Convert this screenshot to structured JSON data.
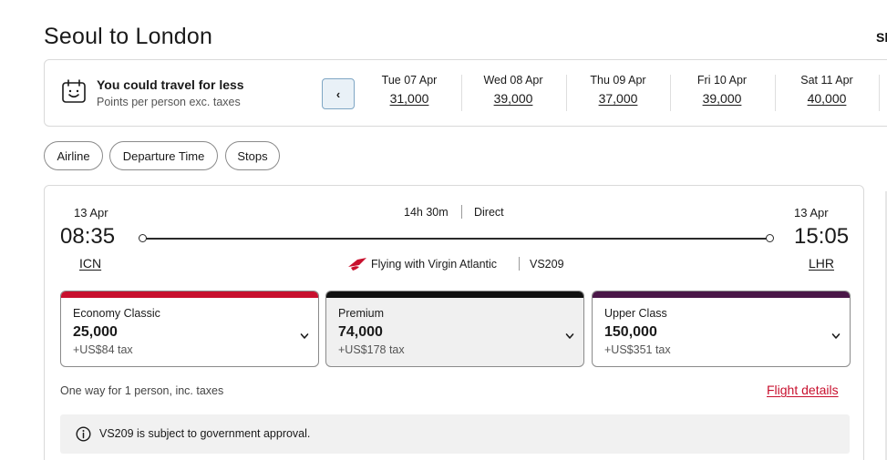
{
  "page": {
    "title": "Seoul to London",
    "top_right_cut": "Sh"
  },
  "promo": {
    "icon": "calendar-smile-icon",
    "title": "You could travel for less",
    "subtitle": "Points per person exc. taxes",
    "prev_symbol": "‹"
  },
  "dates": [
    {
      "label": "Tue 07 Apr",
      "price": "31,000"
    },
    {
      "label": "Wed 08 Apr",
      "price": "39,000"
    },
    {
      "label": "Thu 09 Apr",
      "price": "37,000"
    },
    {
      "label": "Fri 10 Apr",
      "price": "39,000"
    },
    {
      "label": "Sat 11 Apr",
      "price": "40,000"
    }
  ],
  "filters": {
    "airline": "Airline",
    "departure_time": "Departure Time",
    "stops": "Stops"
  },
  "flight": {
    "departure": {
      "date": "13 Apr",
      "time": "08:35",
      "code": "ICN"
    },
    "arrival": {
      "date": "13 Apr",
      "time": "15:05",
      "code": "LHR"
    },
    "duration": "14h 30m",
    "stops": "Direct",
    "operator": "Flying with Virgin Atlantic",
    "flight_number": "VS209",
    "cabins": [
      {
        "name": "Economy Classic",
        "price": "25,000",
        "tax": "+US$84 tax",
        "color": "#c8102e",
        "bg": "#ffffff"
      },
      {
        "name": "Premium",
        "price": "74,000",
        "tax": "+US$178 tax",
        "color": "#111111",
        "bg": "#f0f0f0"
      },
      {
        "name": "Upper Class",
        "price": "150,000",
        "tax": "+US$351 tax",
        "color": "#4a1748",
        "bg": "#ffffff"
      }
    ],
    "fare_note": "One way for 1 person, inc. taxes",
    "details_link": "Flight details",
    "notice": "VS209 is subject to government approval."
  },
  "colors": {
    "accent_red": "#c8102e",
    "premium_black": "#111111",
    "upper_purple": "#4a1748",
    "prev_button_bg": "#e9f1f7"
  }
}
